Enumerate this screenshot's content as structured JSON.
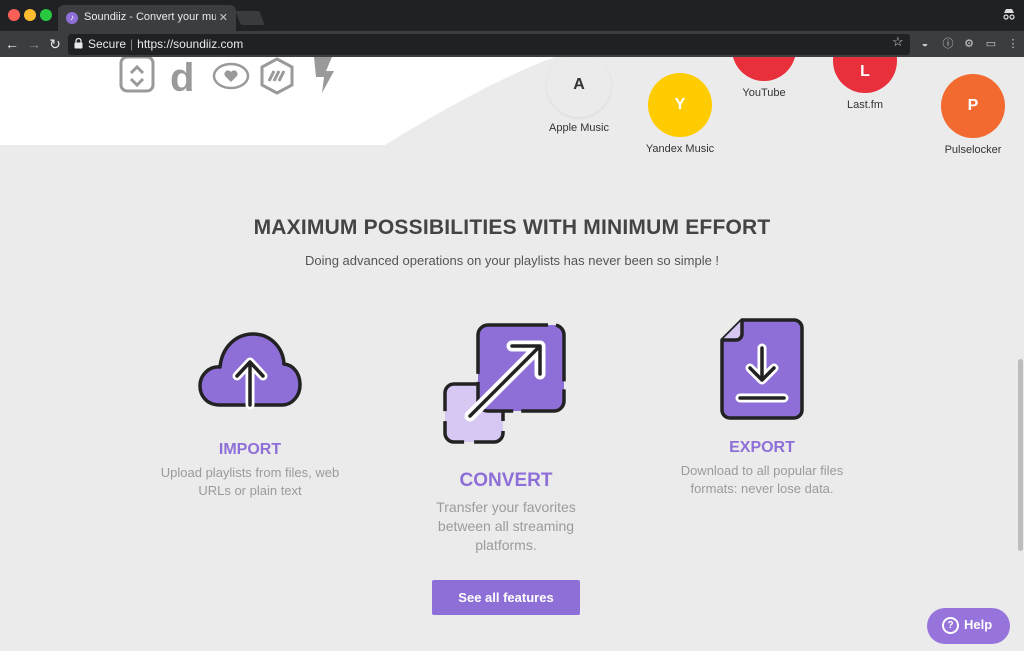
{
  "browser": {
    "tab_title": "Soundiiz - Convert your music",
    "secure_label": "Secure",
    "url": "https://soundiiz.com"
  },
  "services": [
    {
      "initial": "A",
      "name": "Apple Music",
      "color": "#f7f7f7",
      "text_color": "#333333"
    },
    {
      "initial": "Y",
      "name": "Yandex Music",
      "color": "#ffcc00",
      "text_color": "#ffffff"
    },
    {
      "initial": "",
      "name": "YouTube",
      "color": "#e8303c",
      "text_color": "#ffffff"
    },
    {
      "initial": "L",
      "name": "Last.fm",
      "color": "#e8303c",
      "text_color": "#ffffff"
    },
    {
      "initial": "P",
      "name": "Pulselocker",
      "color": "#f26a30",
      "text_color": "#ffffff"
    }
  ],
  "section": {
    "headline": "MAXIMUM POSSIBILITIES WITH MINIMUM EFFORT",
    "subline": "Doing advanced operations on your playlists has never been so simple !"
  },
  "features": {
    "import": {
      "title": "IMPORT",
      "description": "Upload playlists from files, web URLs or plain text"
    },
    "convert": {
      "title": "CONVERT",
      "description": "Transfer your favorites between all streaming platforms."
    },
    "export": {
      "title": "EXPORT",
      "description": "Download to all popular files formats: never lose data."
    }
  },
  "cta": {
    "see_all_label": "See all features"
  },
  "help": {
    "label": "Help"
  },
  "colors": {
    "accent": "#8e6fd8",
    "accent_light": "#d6c7f3",
    "outline": "#222222"
  }
}
